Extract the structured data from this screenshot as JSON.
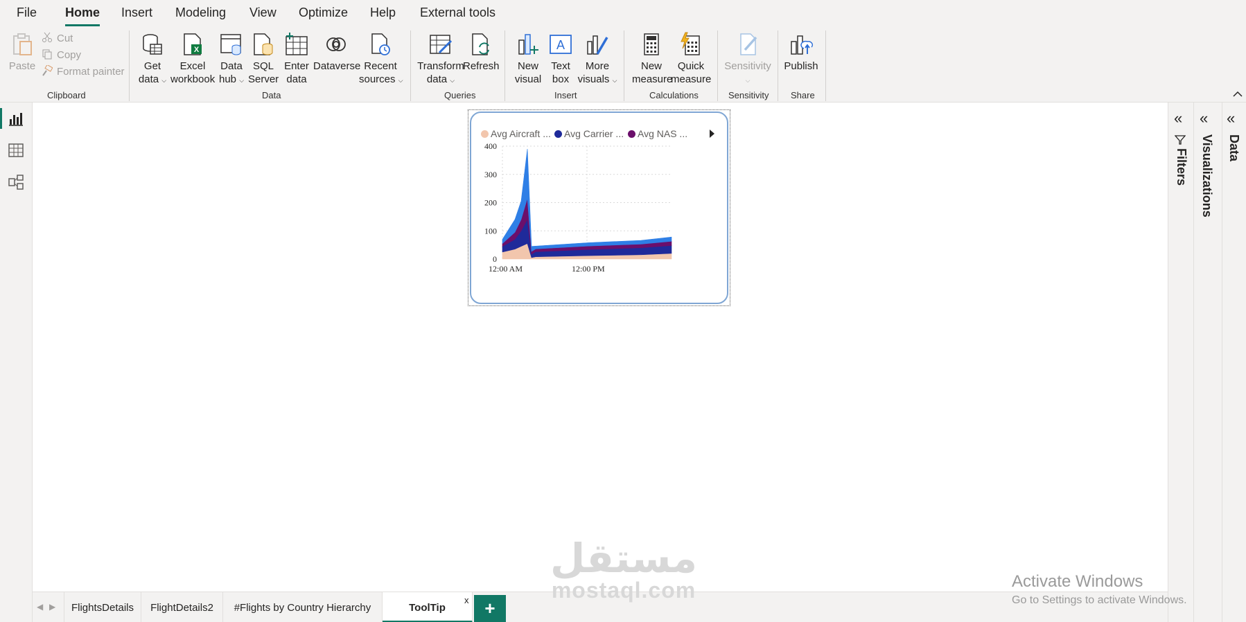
{
  "menu": {
    "items": [
      "File",
      "Home",
      "Insert",
      "Modeling",
      "View",
      "Optimize",
      "Help",
      "External tools"
    ],
    "active": "Home"
  },
  "ribbon": {
    "clipboard": {
      "paste": "Paste",
      "cut": "Cut",
      "copy": "Copy",
      "format_painter": "Format painter",
      "group": "Clipboard"
    },
    "data": {
      "get_data": [
        "Get",
        "data"
      ],
      "excel": [
        "Excel",
        "workbook"
      ],
      "data_hub": [
        "Data",
        "hub"
      ],
      "sql": [
        "SQL",
        "Server"
      ],
      "enter_data": [
        "Enter",
        "data"
      ],
      "dataverse": [
        "Dataverse",
        ""
      ],
      "recent": [
        "Recent",
        "sources"
      ],
      "group": "Data"
    },
    "queries": {
      "transform": [
        "Transform",
        "data"
      ],
      "refresh": [
        "Refresh",
        ""
      ],
      "group": "Queries"
    },
    "insert": {
      "new_visual": [
        "New",
        "visual"
      ],
      "text_box": [
        "Text",
        "box"
      ],
      "more_visuals": [
        "More",
        "visuals"
      ],
      "group": "Insert"
    },
    "calculations": {
      "new_measure": [
        "New",
        "measure"
      ],
      "quick_measure": [
        "Quick",
        "measure"
      ],
      "group": "Calculations"
    },
    "sensitivity": {
      "label": "Sensitivity",
      "group": "Sensitivity"
    },
    "share": {
      "publish": "Publish",
      "group": "Share"
    }
  },
  "chart_data": {
    "type": "area",
    "legend": [
      "Avg Aircraft ...",
      "Avg Carrier ...",
      "Avg NAS ..."
    ],
    "legend_overflow": true,
    "series": [
      {
        "name": "Avg Aircraft ...",
        "color": "#f2c6ad"
      },
      {
        "name": "Avg Carrier ...",
        "color": "#1f2a9a"
      },
      {
        "name": "Avg NAS ...",
        "color": "#6b0f6b"
      },
      {
        "color": "#2f7fe6"
      }
    ],
    "x_ticks": [
      "12:00 AM",
      "12:00 PM"
    ],
    "y_ticks": [
      "0",
      "100",
      "200",
      "300",
      "400"
    ],
    "ylim": [
      0,
      400
    ],
    "grid": true,
    "x": [
      "12:00 AM",
      "2:00 AM",
      "3:00 AM",
      "4:00 AM",
      "5:00 AM",
      "6:00 AM",
      "12:00 PM",
      "6:00 PM",
      "11:59 PM"
    ],
    "stack_values": [
      [
        25,
        35,
        45,
        55,
        5,
        8,
        12,
        15,
        20
      ],
      [
        20,
        35,
        55,
        85,
        12,
        18,
        22,
        25,
        28
      ],
      [
        10,
        25,
        40,
        75,
        10,
        10,
        12,
        13,
        15
      ],
      [
        15,
        45,
        65,
        175,
        18,
        10,
        12,
        13,
        15
      ]
    ]
  },
  "panes": {
    "filters": "Filters",
    "visualizations": "Visualizations",
    "data": "Data"
  },
  "pages": {
    "tabs": [
      "FlightsDetails",
      "FlightDetails2",
      "#Flights by Country Hierarchy",
      "ToolTip"
    ],
    "active": "ToolTip",
    "close": "x",
    "add": "+"
  },
  "watermark": {
    "arabic": "مستقل",
    "latin": "mostaql.com"
  },
  "activation": {
    "title": "Activate Windows",
    "subtitle": "Go to Settings to activate Windows."
  }
}
